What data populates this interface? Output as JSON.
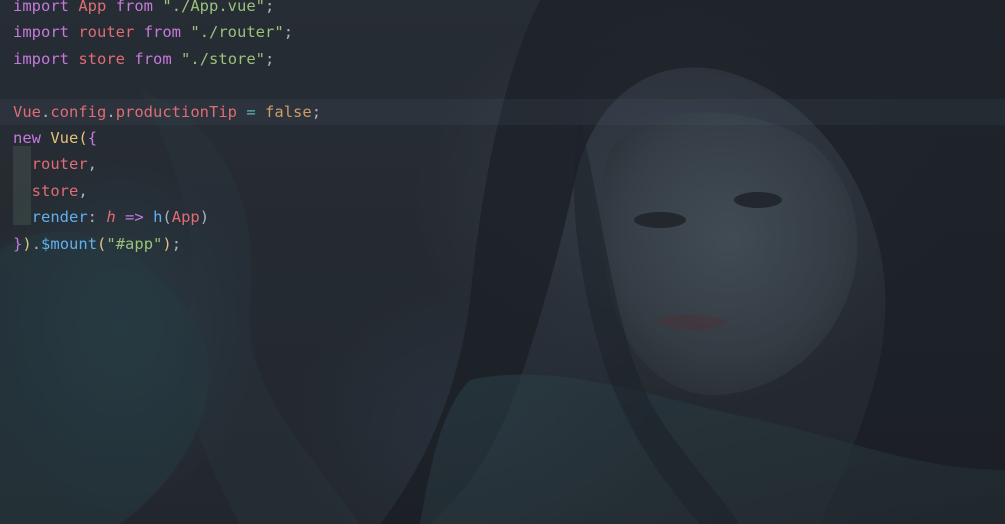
{
  "editor": {
    "language": "javascript",
    "lines": [
      [
        {
          "t": "import",
          "c": "kw"
        },
        {
          "t": " ",
          "c": "punc"
        },
        {
          "t": "App",
          "c": "ident"
        },
        {
          "t": " ",
          "c": "punc"
        },
        {
          "t": "from",
          "c": "kw"
        },
        {
          "t": " ",
          "c": "punc"
        },
        {
          "t": "\"./App.vue\"",
          "c": "str"
        },
        {
          "t": ";",
          "c": "punc"
        }
      ],
      [
        {
          "t": "import",
          "c": "kw"
        },
        {
          "t": " ",
          "c": "punc"
        },
        {
          "t": "router",
          "c": "ident"
        },
        {
          "t": " ",
          "c": "punc"
        },
        {
          "t": "from",
          "c": "kw"
        },
        {
          "t": " ",
          "c": "punc"
        },
        {
          "t": "\"./router\"",
          "c": "str"
        },
        {
          "t": ";",
          "c": "punc"
        }
      ],
      [
        {
          "t": "import",
          "c": "kw"
        },
        {
          "t": " ",
          "c": "punc"
        },
        {
          "t": "store",
          "c": "ident"
        },
        {
          "t": " ",
          "c": "punc"
        },
        {
          "t": "from",
          "c": "kw"
        },
        {
          "t": " ",
          "c": "punc"
        },
        {
          "t": "\"./store\"",
          "c": "str"
        },
        {
          "t": ";",
          "c": "punc"
        }
      ],
      [],
      [
        {
          "t": "Vue",
          "c": "ident"
        },
        {
          "t": ".",
          "c": "punc"
        },
        {
          "t": "config",
          "c": "ident"
        },
        {
          "t": ".",
          "c": "punc"
        },
        {
          "t": "productionTip",
          "c": "ident"
        },
        {
          "t": " ",
          "c": "punc"
        },
        {
          "t": "=",
          "c": "op"
        },
        {
          "t": " ",
          "c": "punc"
        },
        {
          "t": "false",
          "c": "bool"
        },
        {
          "t": ";",
          "c": "punc"
        }
      ],
      [
        {
          "t": "new",
          "c": "kw"
        },
        {
          "t": " ",
          "c": "punc"
        },
        {
          "t": "Vue",
          "c": "cls"
        },
        {
          "t": "(",
          "c": "paren-fn"
        },
        {
          "t": "{",
          "c": "brace"
        }
      ],
      [
        {
          "t": "  ",
          "c": "punc"
        },
        {
          "t": "router",
          "c": "prop"
        },
        {
          "t": ",",
          "c": "punc"
        }
      ],
      [
        {
          "t": "  ",
          "c": "punc"
        },
        {
          "t": "store",
          "c": "prop"
        },
        {
          "t": ",",
          "c": "punc"
        }
      ],
      [
        {
          "t": "  ",
          "c": "punc"
        },
        {
          "t": "render",
          "c": "fn"
        },
        {
          "t": ":",
          "c": "punc"
        },
        {
          "t": " ",
          "c": "punc"
        },
        {
          "t": "h",
          "c": "param"
        },
        {
          "t": " ",
          "c": "punc"
        },
        {
          "t": "=>",
          "c": "kw"
        },
        {
          "t": " ",
          "c": "punc"
        },
        {
          "t": "h",
          "c": "fn"
        },
        {
          "t": "(",
          "c": "punc"
        },
        {
          "t": "App",
          "c": "ident"
        },
        {
          "t": ")",
          "c": "punc"
        }
      ],
      [
        {
          "t": "}",
          "c": "brace"
        },
        {
          "t": ")",
          "c": "paren-fn"
        },
        {
          "t": ".",
          "c": "punc"
        },
        {
          "t": "$mount",
          "c": "fn"
        },
        {
          "t": "(",
          "c": "paren-fn"
        },
        {
          "t": "\"#app\"",
          "c": "str"
        },
        {
          "t": ")",
          "c": "paren-fn"
        },
        {
          "t": ";",
          "c": "punc"
        }
      ]
    ]
  },
  "background": {
    "image": "woman-portrait-illustration",
    "tint": "#23272e"
  },
  "colors": {
    "keyword": "#c678dd",
    "identifier": "#e06c75",
    "string": "#98c379",
    "boolean": "#d19a66",
    "class": "#e5c07b",
    "function": "#61afef",
    "operator": "#56b6c2",
    "punctuation": "#abb2bf"
  }
}
